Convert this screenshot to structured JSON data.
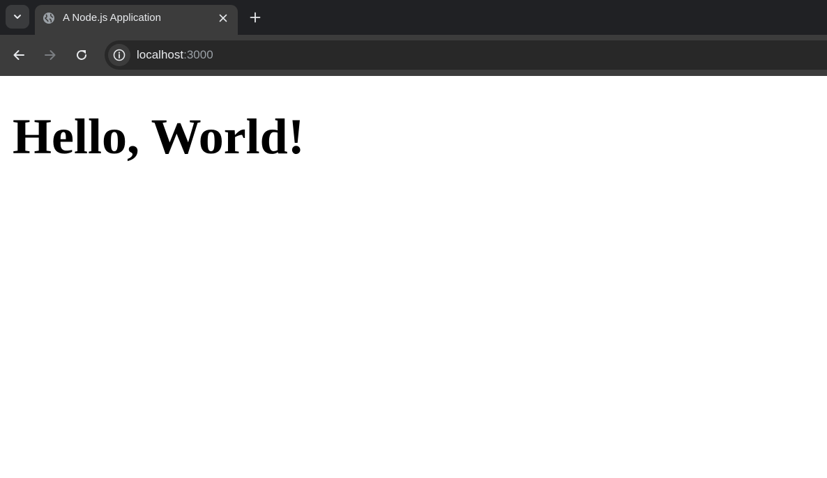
{
  "tab": {
    "title": "A Node.js Application"
  },
  "address_bar": {
    "host": "localhost",
    "port": ":3000"
  },
  "page": {
    "heading": "Hello, World!"
  },
  "icons": {
    "tab_search": "chevron-down-icon",
    "favicon": "globe-icon",
    "tab_close": "close-icon",
    "new_tab": "plus-icon",
    "back": "arrow-left-icon",
    "forward": "arrow-right-icon",
    "reload": "reload-icon",
    "site_info": "info-icon"
  },
  "colors": {
    "tabstrip_bg": "#202124",
    "active_tab_bg": "#3c3c3c",
    "omnibox_bg": "#282828",
    "page_bg": "#ffffff",
    "text_light": "#e8eaed"
  }
}
